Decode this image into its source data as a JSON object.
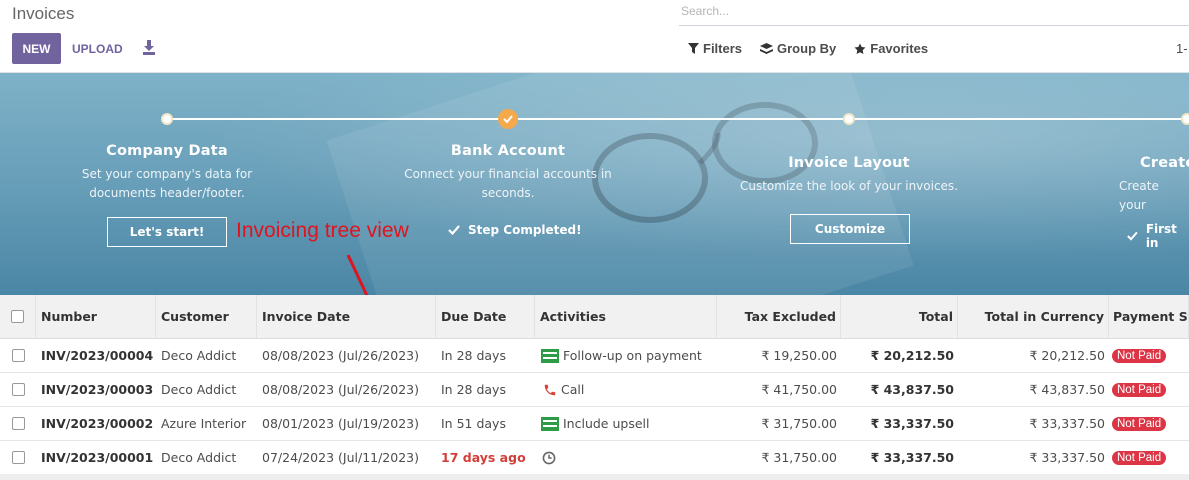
{
  "header": {
    "title": "Invoices",
    "new_label": "NEW",
    "upload_label": "UPLOAD",
    "search_placeholder": "Search...",
    "filters_label": "Filters",
    "group_by_label": "Group By",
    "favorites_label": "Favorites",
    "pager": "1-"
  },
  "onboarding": {
    "steps": [
      {
        "title": "Company Data",
        "description": "Set your company's data for documents header/footer.",
        "action": "Let's start!",
        "state": "todo"
      },
      {
        "title": "Bank Account",
        "description": "Connect your financial accounts in seconds.",
        "action": "Step Completed!",
        "state": "done"
      },
      {
        "title": "Invoice Layout",
        "description": "Customize the look of your invoices.",
        "action": "Customize",
        "state": "todo"
      },
      {
        "title": "Create",
        "description": "Create your",
        "action": "First in",
        "state": "done"
      }
    ],
    "annotation": "Invoicing tree view"
  },
  "table": {
    "columns": [
      "Number",
      "Customer",
      "Invoice Date",
      "Due Date",
      "Activities",
      "Tax Excluded",
      "Total",
      "Total in Currency",
      "Payment Sta"
    ],
    "rows": [
      {
        "number": "INV/2023/00004",
        "customer": "Deco Addict",
        "invoice_date": "08/08/2023 (Jul/26/2023)",
        "due": "In 28 days",
        "activity": "Follow-up on payment",
        "activity_icon": "spreadsheet-icon",
        "tax_excluded": "₹ 19,250.00",
        "total": "₹ 20,212.50",
        "total_currency": "₹ 20,212.50",
        "status": "Not Paid"
      },
      {
        "number": "INV/2023/00003",
        "customer": "Deco Addict",
        "invoice_date": "08/08/2023 (Jul/26/2023)",
        "due": "In 28 days",
        "activity": "Call",
        "activity_icon": "phone-icon",
        "tax_excluded": "₹ 41,750.00",
        "total": "₹ 43,837.50",
        "total_currency": "₹ 43,837.50",
        "status": "Not Paid"
      },
      {
        "number": "INV/2023/00002",
        "customer": "Azure Interior",
        "invoice_date": "08/01/2023 (Jul/19/2023)",
        "due": "In 51 days",
        "activity": "Include upsell",
        "activity_icon": "spreadsheet-icon",
        "tax_excluded": "₹ 31,750.00",
        "total": "₹ 33,337.50",
        "total_currency": "₹ 33,337.50",
        "status": "Not Paid"
      },
      {
        "number": "INV/2023/00001",
        "customer": "Deco Addict",
        "invoice_date": "07/24/2023 (Jul/11/2023)",
        "due": "17 days ago",
        "activity": "",
        "activity_icon": "clock-icon",
        "tax_excluded": "₹ 31,750.00",
        "total": "₹ 33,337.50",
        "total_currency": "₹ 33,337.50",
        "status": "Not Paid"
      }
    ]
  },
  "colors": {
    "brand": "#71639e",
    "danger": "#dc3545",
    "overdue": "#d23f3a",
    "step_done": "#f4a94b"
  }
}
